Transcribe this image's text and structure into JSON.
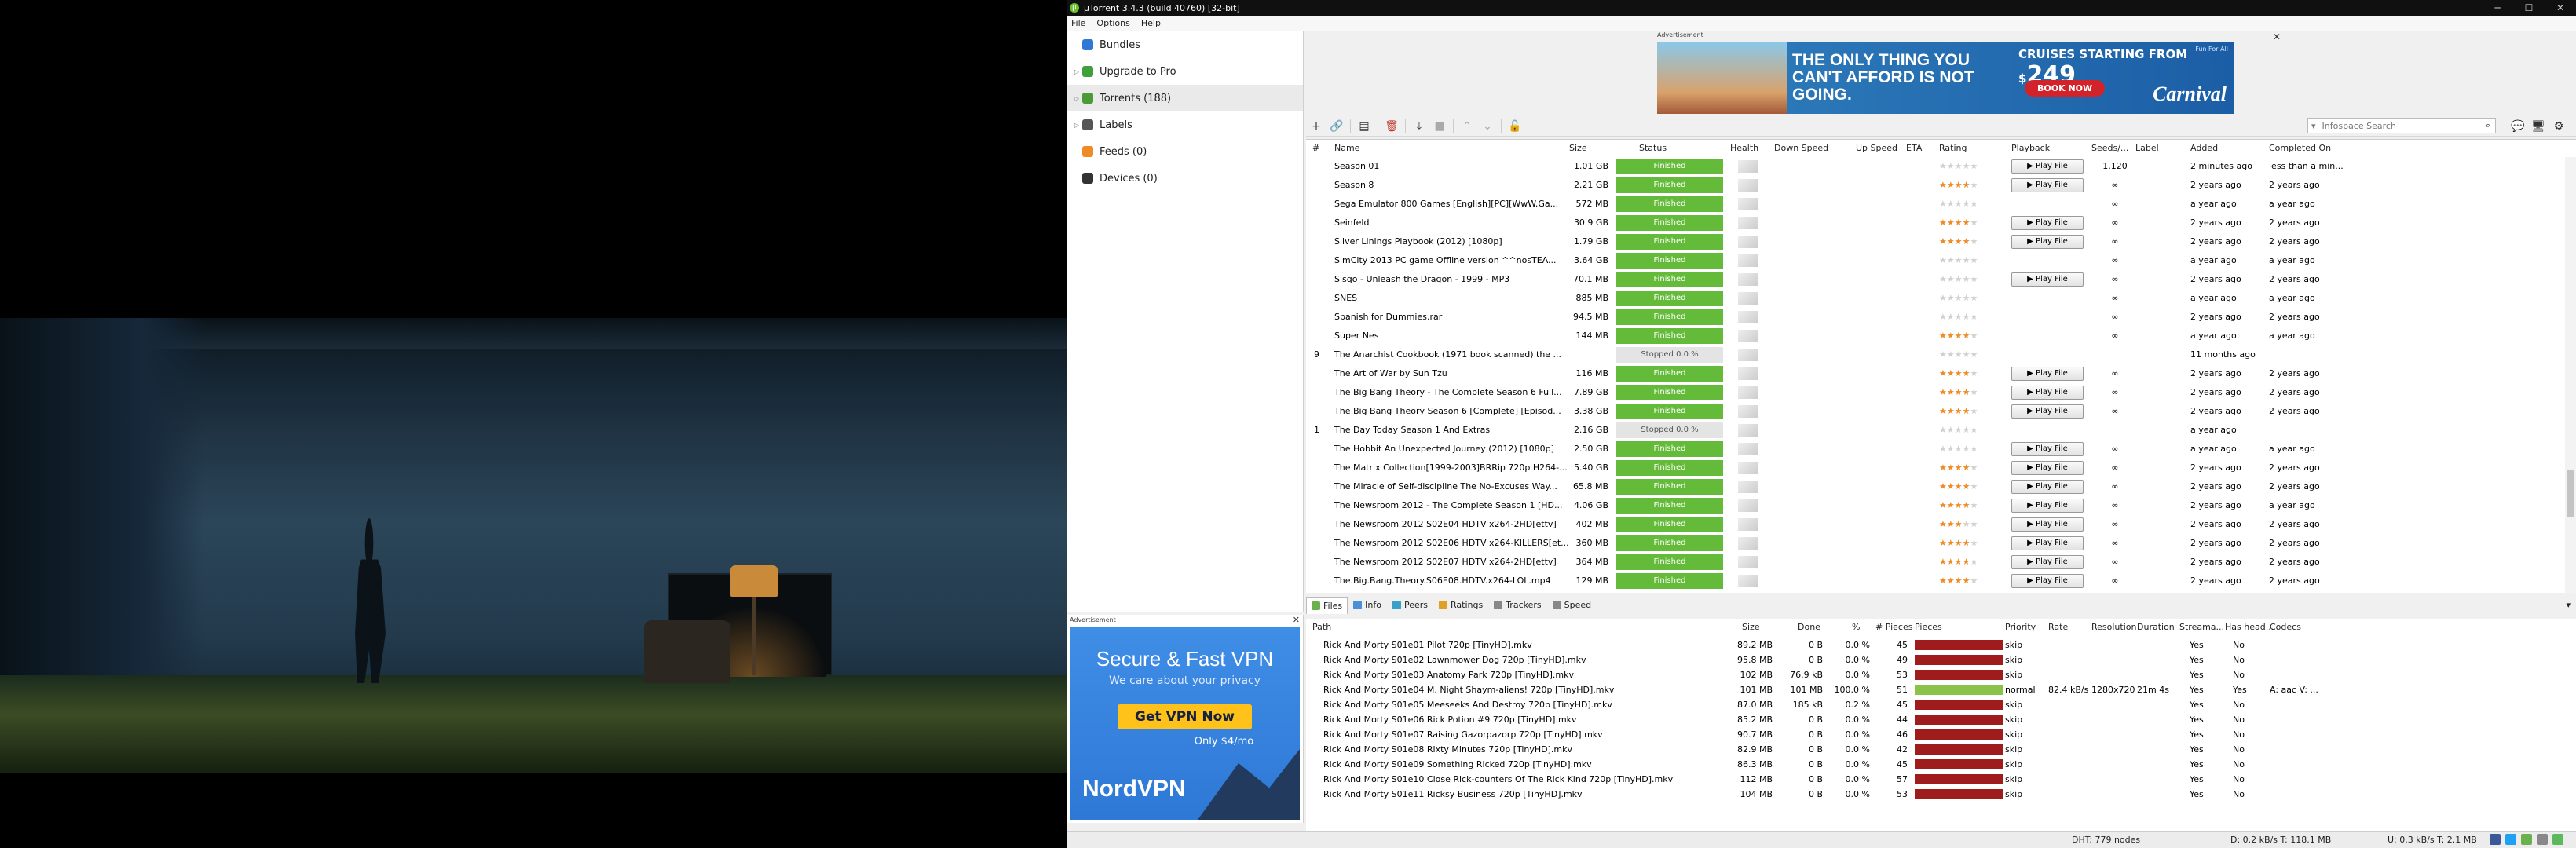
{
  "window": {
    "title": "µTorrent 3.4.3  (build 40760) [32-bit]"
  },
  "menu": [
    "File",
    "Options",
    "Help"
  ],
  "sidebar": {
    "items": [
      {
        "label": "Bundles",
        "icon": "bundles-icon",
        "color": "#2f78d6"
      },
      {
        "label": "Upgrade to Pro",
        "icon": "pro-icon",
        "color": "#3fa13a"
      },
      {
        "label": "Torrents (188)",
        "icon": "torrents-icon",
        "color": "#4a9a3a"
      },
      {
        "label": "Labels",
        "icon": "tag-icon",
        "color": "#555555"
      },
      {
        "label": "Feeds (0)",
        "icon": "rss-icon",
        "color": "#f08a24"
      },
      {
        "label": "Devices (0)",
        "icon": "device-icon",
        "color": "#333333"
      }
    ]
  },
  "ads": {
    "label": "Advertisement",
    "close": "✕",
    "carnival": {
      "headline": "THE ONLY THING YOU CAN'T AFFORD IS NOT GOING.",
      "offer_prefix": "CRUISES STARTING FROM $",
      "price": "249",
      "button": "BOOK NOW",
      "logo": "Carnival",
      "fine": "Fun For All"
    },
    "vpn": {
      "headline": "Secure & Fast VPN",
      "sub": "We care about your privacy",
      "button": "Get VPN Now",
      "price": "Only $4/mo",
      "brand": "NordVPN"
    }
  },
  "toolbar": {
    "search_placeholder": "Infospace Search"
  },
  "torrents": {
    "columns": [
      "#",
      "Name",
      "Size",
      "Status",
      "Health",
      "Down Speed",
      "Up Speed",
      "ETA",
      "Rating",
      "Playback",
      "Seeds/...",
      "Label",
      "Added",
      "Completed On"
    ],
    "play_label": "▶ Play File",
    "rows": [
      {
        "num": "",
        "name": "Season 01",
        "size": "1.01 GB",
        "status": "Finished",
        "stopped": false,
        "rating": 0,
        "play": true,
        "seeds": "1.120",
        "added": "2 minutes ago",
        "completed": "less than a min..."
      },
      {
        "num": "",
        "name": "Season 8",
        "size": "2.21 GB",
        "status": "Finished",
        "stopped": false,
        "rating": 4,
        "play": true,
        "seeds": "∞",
        "added": "2 years ago",
        "completed": "2 years ago"
      },
      {
        "num": "",
        "name": "Sega Emulator 800 Games [English][PC][WwW.Ga...",
        "size": "572 MB",
        "status": "Finished",
        "stopped": false,
        "rating": 0,
        "play": false,
        "seeds": "∞",
        "added": "a year ago",
        "completed": "a year ago"
      },
      {
        "num": "",
        "name": "Seinfeld",
        "size": "30.9 GB",
        "status": "Finished",
        "stopped": false,
        "rating": 4,
        "play": true,
        "seeds": "∞",
        "added": "2 years ago",
        "completed": "2 years ago"
      },
      {
        "num": "",
        "name": "Silver Linings Playbook (2012) [1080p]",
        "size": "1.79 GB",
        "status": "Finished",
        "stopped": false,
        "rating": 4,
        "play": true,
        "seeds": "∞",
        "added": "2 years ago",
        "completed": "2 years ago"
      },
      {
        "num": "",
        "name": "SimCity 2013 PC game Offline version ^^nosTEA...",
        "size": "3.64 GB",
        "status": "Finished",
        "stopped": false,
        "rating": 0,
        "play": false,
        "seeds": "∞",
        "added": "a year ago",
        "completed": "a year ago"
      },
      {
        "num": "",
        "name": "Sisqo  -  Unleash the Dragon - 1999 - MP3",
        "size": "70.1 MB",
        "status": "Finished",
        "stopped": false,
        "rating": 0,
        "play": true,
        "seeds": "∞",
        "added": "2 years ago",
        "completed": "2 years ago"
      },
      {
        "num": "",
        "name": "SNES",
        "size": "885 MB",
        "status": "Finished",
        "stopped": false,
        "rating": 0,
        "play": false,
        "seeds": "∞",
        "added": "a year ago",
        "completed": "a year ago"
      },
      {
        "num": "",
        "name": "Spanish for Dummies.rar",
        "size": "94.5 MB",
        "status": "Finished",
        "stopped": false,
        "rating": 0,
        "play": false,
        "seeds": "∞",
        "added": "2 years ago",
        "completed": "2 years ago"
      },
      {
        "num": "",
        "name": "Super Nes",
        "size": "144 MB",
        "status": "Finished",
        "stopped": false,
        "rating": 4,
        "play": false,
        "seeds": "∞",
        "added": "a year ago",
        "completed": "a year ago"
      },
      {
        "num": "9",
        "name": "The Anarchist Cookbook (1971 book scanned) the ...",
        "size": "",
        "status": "Stopped 0.0 %",
        "stopped": true,
        "rating": 0,
        "play": false,
        "seeds": "",
        "added": "11 months ago",
        "completed": ""
      },
      {
        "num": "",
        "name": "The Art of War by Sun Tzu",
        "size": "116 MB",
        "status": "Finished",
        "stopped": false,
        "rating": 4,
        "play": true,
        "seeds": "∞",
        "added": "2 years ago",
        "completed": "2 years ago"
      },
      {
        "num": "",
        "name": "The Big Bang Theory - The Complete Season 6 Full...",
        "size": "7.89 GB",
        "status": "Finished",
        "stopped": false,
        "rating": 4,
        "play": true,
        "seeds": "∞",
        "added": "2 years ago",
        "completed": "2 years ago"
      },
      {
        "num": "",
        "name": "The Big Bang Theory Season 6 [Complete] [Episod...",
        "size": "3.38 GB",
        "status": "Finished",
        "stopped": false,
        "rating": 4,
        "play": true,
        "seeds": "∞",
        "added": "2 years ago",
        "completed": "2 years ago"
      },
      {
        "num": "1",
        "name": "The Day Today Season 1 And Extras",
        "size": "2.16 GB",
        "status": "Stopped 0.0 %",
        "stopped": true,
        "rating": 0,
        "play": false,
        "seeds": "",
        "added": "a year ago",
        "completed": ""
      },
      {
        "num": "",
        "name": "The Hobbit An Unexpected Journey (2012) [1080p]",
        "size": "2.50 GB",
        "status": "Finished",
        "stopped": false,
        "rating": 0,
        "play": true,
        "seeds": "∞",
        "added": "a year ago",
        "completed": "a year ago"
      },
      {
        "num": "",
        "name": "The Matrix Collection[1999-2003]BRRip 720p H264-...",
        "size": "5.40 GB",
        "status": "Finished",
        "stopped": false,
        "rating": 4,
        "play": true,
        "seeds": "∞",
        "added": "2 years ago",
        "completed": "2 years ago"
      },
      {
        "num": "",
        "name": "The Miracle of Self-discipline The No-Excuses Way...",
        "size": "65.8 MB",
        "status": "Finished",
        "stopped": false,
        "rating": 4,
        "play": true,
        "seeds": "∞",
        "added": "2 years ago",
        "completed": "2 years ago"
      },
      {
        "num": "",
        "name": "The Newsroom 2012 - The Complete Season 1 [HD...",
        "size": "4.06 GB",
        "status": "Finished",
        "stopped": false,
        "rating": 4,
        "play": true,
        "seeds": "∞",
        "added": "2 years ago",
        "completed": "a year ago"
      },
      {
        "num": "",
        "name": "The Newsroom 2012 S02E04 HDTV x264-2HD[ettv]",
        "size": "402 MB",
        "status": "Finished",
        "stopped": false,
        "rating": 3,
        "play": true,
        "seeds": "∞",
        "added": "2 years ago",
        "completed": "2 years ago"
      },
      {
        "num": "",
        "name": "The Newsroom 2012 S02E06 HDTV x264-KILLERS[et...",
        "size": "360 MB",
        "status": "Finished",
        "stopped": false,
        "rating": 4,
        "play": true,
        "seeds": "∞",
        "added": "2 years ago",
        "completed": "2 years ago"
      },
      {
        "num": "",
        "name": "The Newsroom 2012 S02E07 HDTV x264-2HD[ettv]",
        "size": "364 MB",
        "status": "Finished",
        "stopped": false,
        "rating": 4,
        "play": true,
        "seeds": "∞",
        "added": "2 years ago",
        "completed": "2 years ago"
      },
      {
        "num": "",
        "name": "The.Big.Bang.Theory.S06E08.HDTV.x264-LOL.mp4",
        "size": "129 MB",
        "status": "Finished",
        "stopped": false,
        "rating": 4,
        "play": true,
        "seeds": "∞",
        "added": "2 years ago",
        "completed": "2 years ago"
      }
    ]
  },
  "tabs": [
    {
      "label": "Files",
      "active": true,
      "color": "#6ab04c"
    },
    {
      "label": "Info",
      "active": false,
      "color": "#4a90d9"
    },
    {
      "label": "Peers",
      "active": false,
      "color": "#3aa0c8"
    },
    {
      "label": "Ratings",
      "active": false,
      "color": "#e0a020"
    },
    {
      "label": "Trackers",
      "active": false,
      "color": "#888888"
    },
    {
      "label": "Speed",
      "active": false,
      "color": "#888888"
    }
  ],
  "files": {
    "columns": [
      "Path",
      "Size",
      "Done",
      "%",
      "# Pieces",
      "Pieces",
      "Priority",
      "Rate",
      "Resolution",
      "Duration",
      "Streama...",
      "Has head...",
      "Codecs"
    ],
    "rows": [
      {
        "path": "Rick And Morty S01e01 Pilot 720p [TinyHD].mkv",
        "size": "89.2 MB",
        "done": "0 B",
        "pct": "0.0 %",
        "pieces": "45",
        "full": false,
        "priority": "skip",
        "rate": "",
        "res": "",
        "dur": "",
        "stream": "Yes",
        "head": "No",
        "codecs": ""
      },
      {
        "path": "Rick And Morty S01e02 Lawnmower Dog 720p [TinyHD].mkv",
        "size": "95.8 MB",
        "done": "0 B",
        "pct": "0.0 %",
        "pieces": "49",
        "full": false,
        "priority": "skip",
        "rate": "",
        "res": "",
        "dur": "",
        "stream": "Yes",
        "head": "No",
        "codecs": ""
      },
      {
        "path": "Rick And Morty S01e03 Anatomy Park 720p [TinyHD].mkv",
        "size": "102 MB",
        "done": "76.9 kB",
        "pct": "0.0 %",
        "pieces": "53",
        "full": false,
        "priority": "skip",
        "rate": "",
        "res": "",
        "dur": "",
        "stream": "Yes",
        "head": "No",
        "codecs": ""
      },
      {
        "path": "Rick And Morty S01e04 M. Night Shaym-aliens! 720p [TinyHD].mkv",
        "size": "101 MB",
        "done": "101 MB",
        "pct": "100.0 %",
        "pieces": "51",
        "full": true,
        "priority": "normal",
        "rate": "82.4 kB/s",
        "res": "1280x720",
        "dur": "21m 4s",
        "stream": "Yes",
        "head": "Yes",
        "codecs": "A: aac V: ..."
      },
      {
        "path": "Rick And Morty S01e05 Meeseeks And Destroy 720p [TinyHD].mkv",
        "size": "87.0 MB",
        "done": "185 kB",
        "pct": "0.2 %",
        "pieces": "45",
        "full": false,
        "priority": "skip",
        "rate": "",
        "res": "",
        "dur": "",
        "stream": "Yes",
        "head": "No",
        "codecs": ""
      },
      {
        "path": "Rick And Morty S01e06 Rick Potion #9 720p [TinyHD].mkv",
        "size": "85.2 MB",
        "done": "0 B",
        "pct": "0.0 %",
        "pieces": "44",
        "full": false,
        "priority": "skip",
        "rate": "",
        "res": "",
        "dur": "",
        "stream": "Yes",
        "head": "No",
        "codecs": ""
      },
      {
        "path": "Rick And Morty S01e07 Raising Gazorpazorp 720p [TinyHD].mkv",
        "size": "90.7 MB",
        "done": "0 B",
        "pct": "0.0 %",
        "pieces": "46",
        "full": false,
        "priority": "skip",
        "rate": "",
        "res": "",
        "dur": "",
        "stream": "Yes",
        "head": "No",
        "codecs": ""
      },
      {
        "path": "Rick And Morty S01e08 Rixty Minutes 720p [TinyHD].mkv",
        "size": "82.9 MB",
        "done": "0 B",
        "pct": "0.0 %",
        "pieces": "42",
        "full": false,
        "priority": "skip",
        "rate": "",
        "res": "",
        "dur": "",
        "stream": "Yes",
        "head": "No",
        "codecs": ""
      },
      {
        "path": "Rick And Morty S01e09 Something Ricked 720p [TinyHD].mkv",
        "size": "86.3 MB",
        "done": "0 B",
        "pct": "0.0 %",
        "pieces": "45",
        "full": false,
        "priority": "skip",
        "rate": "",
        "res": "",
        "dur": "",
        "stream": "Yes",
        "head": "No",
        "codecs": ""
      },
      {
        "path": "Rick And Morty S01e10 Close Rick-counters Of The Rick Kind 720p [TinyHD].mkv",
        "size": "112 MB",
        "done": "0 B",
        "pct": "0.0 %",
        "pieces": "57",
        "full": false,
        "priority": "skip",
        "rate": "",
        "res": "",
        "dur": "",
        "stream": "Yes",
        "head": "No",
        "codecs": ""
      },
      {
        "path": "Rick And Morty S01e11 Ricksy Business 720p [TinyHD].mkv",
        "size": "104 MB",
        "done": "0 B",
        "pct": "0.0 %",
        "pieces": "53",
        "full": false,
        "priority": "skip",
        "rate": "",
        "res": "",
        "dur": "",
        "stream": "Yes",
        "head": "No",
        "codecs": ""
      }
    ]
  },
  "statusbar": {
    "dht": "DHT: 779 nodes",
    "down": "D: 0.2 kB/s T: 118.1 MB",
    "up": "U: 0.3 kB/s T: 2.1 MB"
  },
  "colors": {
    "finished": "#64bb3a",
    "stopped": "#e4e4e4",
    "star": "#f08a24",
    "pieces_missing": "#9e1c1c",
    "pieces_done": "#8bc34a"
  }
}
